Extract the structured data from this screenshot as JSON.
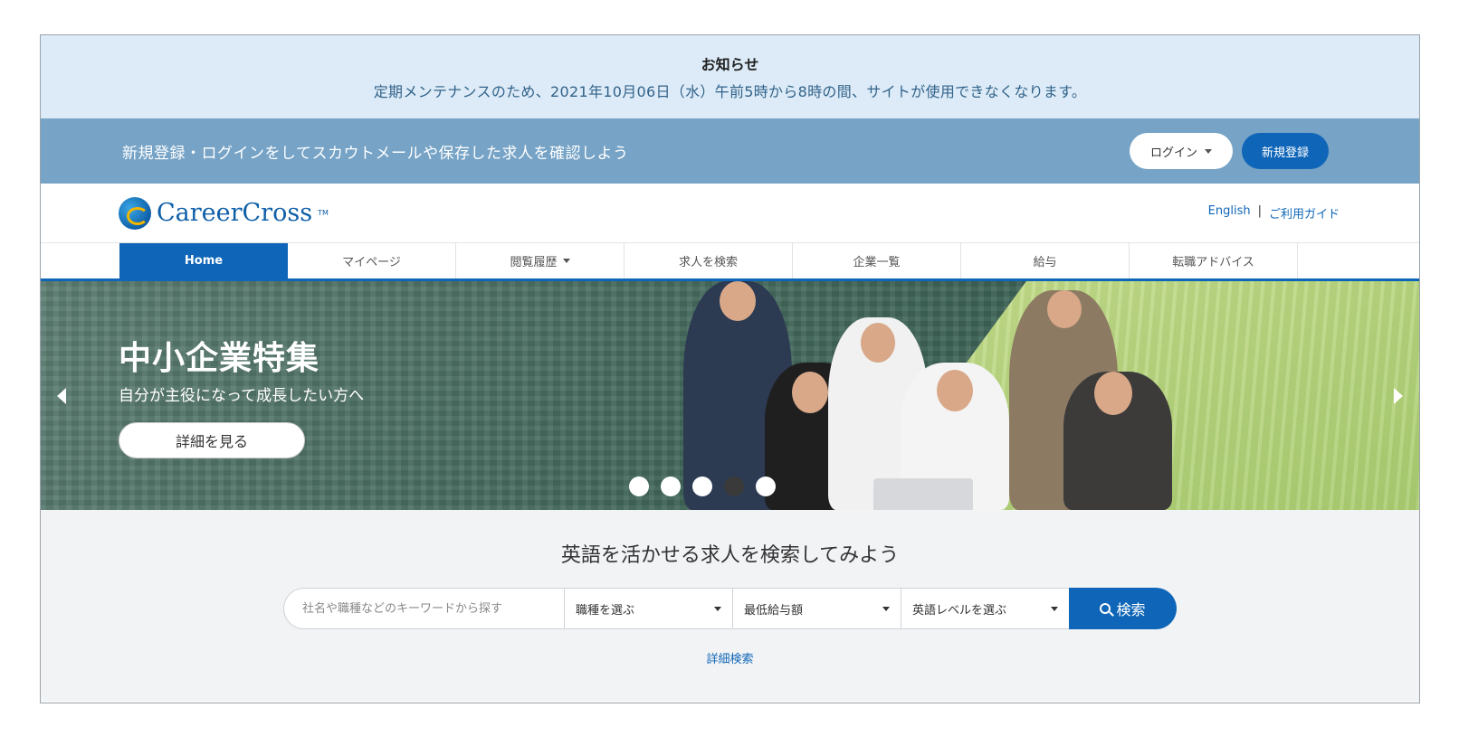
{
  "notice": {
    "title": "お知らせ",
    "text": "定期メンテナンスのため、2021年10月06日（水）午前5時から8時の間、サイトが使用できなくなります。"
  },
  "loginbar": {
    "message": "新規登録・ログインをしてスカウトメールや保存した求人を確認しよう",
    "login_label": "ログイン",
    "register_label": "新規登録"
  },
  "header": {
    "logo_text": "CareerCross",
    "logo_tm": "TM",
    "links": [
      "English",
      "|",
      "ご利用ガイド"
    ]
  },
  "nav": {
    "items": [
      {
        "label": "Home",
        "active": true
      },
      {
        "label": "マイページ"
      },
      {
        "label": "閲覧履歴",
        "dropdown": true
      },
      {
        "label": "求人を検索"
      },
      {
        "label": "企業一覧"
      },
      {
        "label": "給与"
      },
      {
        "label": "転職アドバイス"
      }
    ]
  },
  "hero": {
    "title": "中小企業特集",
    "subtitle": "自分が主役になって成長したい方へ",
    "button_label": "詳細を見る",
    "slides_total": 5,
    "active_slide": 4
  },
  "search": {
    "title": "英語を活かせる求人を検索してみよう",
    "keyword_placeholder": "社名や職種などのキーワードから探す",
    "job_select": "職種を選ぶ",
    "salary_select": "最低給与額",
    "english_select": "英語レベルを選ぶ",
    "button_label": "検索",
    "advanced_link": "詳細検索"
  },
  "colors": {
    "primary": "#0f66b8",
    "notice_bg": "#dcebf7",
    "loginbar_bg": "#76a3c6",
    "search_bg": "#f2f3f5"
  }
}
